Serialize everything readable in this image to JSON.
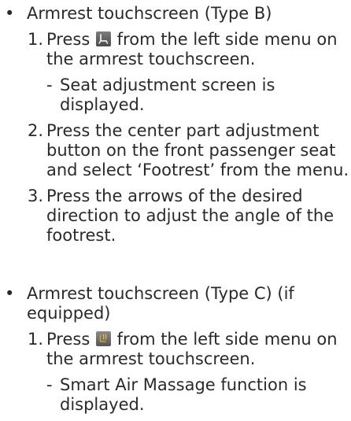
{
  "section_b": {
    "bullet": "•",
    "title": "Armrest touchscreen (Type B)",
    "steps": [
      {
        "num": "1.",
        "text_before": "Press",
        "icon": "seat-adjust-icon",
        "text_after": "from the left side menu on the armrest touchscreen.",
        "sub": {
          "dash": "-",
          "text": "Seat adjustment screen is displayed."
        }
      },
      {
        "num": "2.",
        "text": "Press the center part adjustment button on the front passenger seat and select ‘Footrest’ from the menu."
      },
      {
        "num": "3.",
        "text": "Press the arrows of the desired direction to adjust the angle of the footrest."
      }
    ]
  },
  "section_c": {
    "bullet": "•",
    "title": "Armrest touchscreen (Type C) (if equipped)",
    "steps": [
      {
        "num": "1.",
        "text_before": "Press",
        "icon": "smart-air-massage-icon",
        "text_after": "from the left side menu on the armrest touchscreen.",
        "sub": {
          "dash": "-",
          "text": "Smart Air Massage function is displayed."
        }
      }
    ]
  }
}
